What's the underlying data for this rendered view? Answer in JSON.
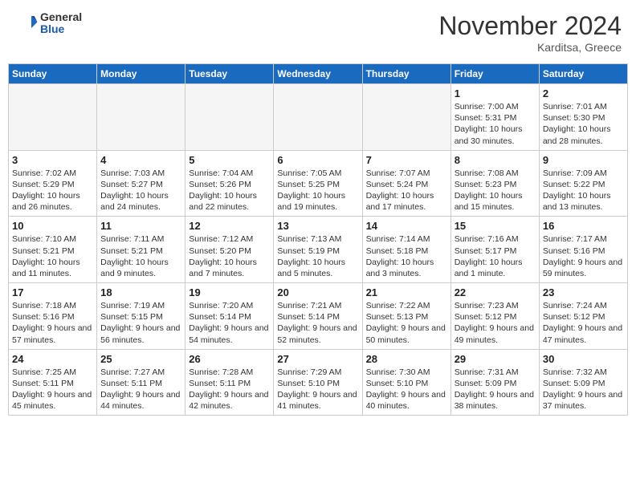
{
  "header": {
    "logo_general": "General",
    "logo_blue": "Blue",
    "month_title": "November 2024",
    "location": "Karditsa, Greece"
  },
  "calendar": {
    "days_of_week": [
      "Sunday",
      "Monday",
      "Tuesday",
      "Wednesday",
      "Thursday",
      "Friday",
      "Saturday"
    ],
    "weeks": [
      [
        {
          "day": "",
          "info": ""
        },
        {
          "day": "",
          "info": ""
        },
        {
          "day": "",
          "info": ""
        },
        {
          "day": "",
          "info": ""
        },
        {
          "day": "",
          "info": ""
        },
        {
          "day": "1",
          "info": "Sunrise: 7:00 AM\nSunset: 5:31 PM\nDaylight: 10 hours and 30 minutes."
        },
        {
          "day": "2",
          "info": "Sunrise: 7:01 AM\nSunset: 5:30 PM\nDaylight: 10 hours and 28 minutes."
        }
      ],
      [
        {
          "day": "3",
          "info": "Sunrise: 7:02 AM\nSunset: 5:29 PM\nDaylight: 10 hours and 26 minutes."
        },
        {
          "day": "4",
          "info": "Sunrise: 7:03 AM\nSunset: 5:27 PM\nDaylight: 10 hours and 24 minutes."
        },
        {
          "day": "5",
          "info": "Sunrise: 7:04 AM\nSunset: 5:26 PM\nDaylight: 10 hours and 22 minutes."
        },
        {
          "day": "6",
          "info": "Sunrise: 7:05 AM\nSunset: 5:25 PM\nDaylight: 10 hours and 19 minutes."
        },
        {
          "day": "7",
          "info": "Sunrise: 7:07 AM\nSunset: 5:24 PM\nDaylight: 10 hours and 17 minutes."
        },
        {
          "day": "8",
          "info": "Sunrise: 7:08 AM\nSunset: 5:23 PM\nDaylight: 10 hours and 15 minutes."
        },
        {
          "day": "9",
          "info": "Sunrise: 7:09 AM\nSunset: 5:22 PM\nDaylight: 10 hours and 13 minutes."
        }
      ],
      [
        {
          "day": "10",
          "info": "Sunrise: 7:10 AM\nSunset: 5:21 PM\nDaylight: 10 hours and 11 minutes."
        },
        {
          "day": "11",
          "info": "Sunrise: 7:11 AM\nSunset: 5:21 PM\nDaylight: 10 hours and 9 minutes."
        },
        {
          "day": "12",
          "info": "Sunrise: 7:12 AM\nSunset: 5:20 PM\nDaylight: 10 hours and 7 minutes."
        },
        {
          "day": "13",
          "info": "Sunrise: 7:13 AM\nSunset: 5:19 PM\nDaylight: 10 hours and 5 minutes."
        },
        {
          "day": "14",
          "info": "Sunrise: 7:14 AM\nSunset: 5:18 PM\nDaylight: 10 hours and 3 minutes."
        },
        {
          "day": "15",
          "info": "Sunrise: 7:16 AM\nSunset: 5:17 PM\nDaylight: 10 hours and 1 minute."
        },
        {
          "day": "16",
          "info": "Sunrise: 7:17 AM\nSunset: 5:16 PM\nDaylight: 9 hours and 59 minutes."
        }
      ],
      [
        {
          "day": "17",
          "info": "Sunrise: 7:18 AM\nSunset: 5:16 PM\nDaylight: 9 hours and 57 minutes."
        },
        {
          "day": "18",
          "info": "Sunrise: 7:19 AM\nSunset: 5:15 PM\nDaylight: 9 hours and 56 minutes."
        },
        {
          "day": "19",
          "info": "Sunrise: 7:20 AM\nSunset: 5:14 PM\nDaylight: 9 hours and 54 minutes."
        },
        {
          "day": "20",
          "info": "Sunrise: 7:21 AM\nSunset: 5:14 PM\nDaylight: 9 hours and 52 minutes."
        },
        {
          "day": "21",
          "info": "Sunrise: 7:22 AM\nSunset: 5:13 PM\nDaylight: 9 hours and 50 minutes."
        },
        {
          "day": "22",
          "info": "Sunrise: 7:23 AM\nSunset: 5:12 PM\nDaylight: 9 hours and 49 minutes."
        },
        {
          "day": "23",
          "info": "Sunrise: 7:24 AM\nSunset: 5:12 PM\nDaylight: 9 hours and 47 minutes."
        }
      ],
      [
        {
          "day": "24",
          "info": "Sunrise: 7:25 AM\nSunset: 5:11 PM\nDaylight: 9 hours and 45 minutes."
        },
        {
          "day": "25",
          "info": "Sunrise: 7:27 AM\nSunset: 5:11 PM\nDaylight: 9 hours and 44 minutes."
        },
        {
          "day": "26",
          "info": "Sunrise: 7:28 AM\nSunset: 5:11 PM\nDaylight: 9 hours and 42 minutes."
        },
        {
          "day": "27",
          "info": "Sunrise: 7:29 AM\nSunset: 5:10 PM\nDaylight: 9 hours and 41 minutes."
        },
        {
          "day": "28",
          "info": "Sunrise: 7:30 AM\nSunset: 5:10 PM\nDaylight: 9 hours and 40 minutes."
        },
        {
          "day": "29",
          "info": "Sunrise: 7:31 AM\nSunset: 5:09 PM\nDaylight: 9 hours and 38 minutes."
        },
        {
          "day": "30",
          "info": "Sunrise: 7:32 AM\nSunset: 5:09 PM\nDaylight: 9 hours and 37 minutes."
        }
      ]
    ]
  }
}
